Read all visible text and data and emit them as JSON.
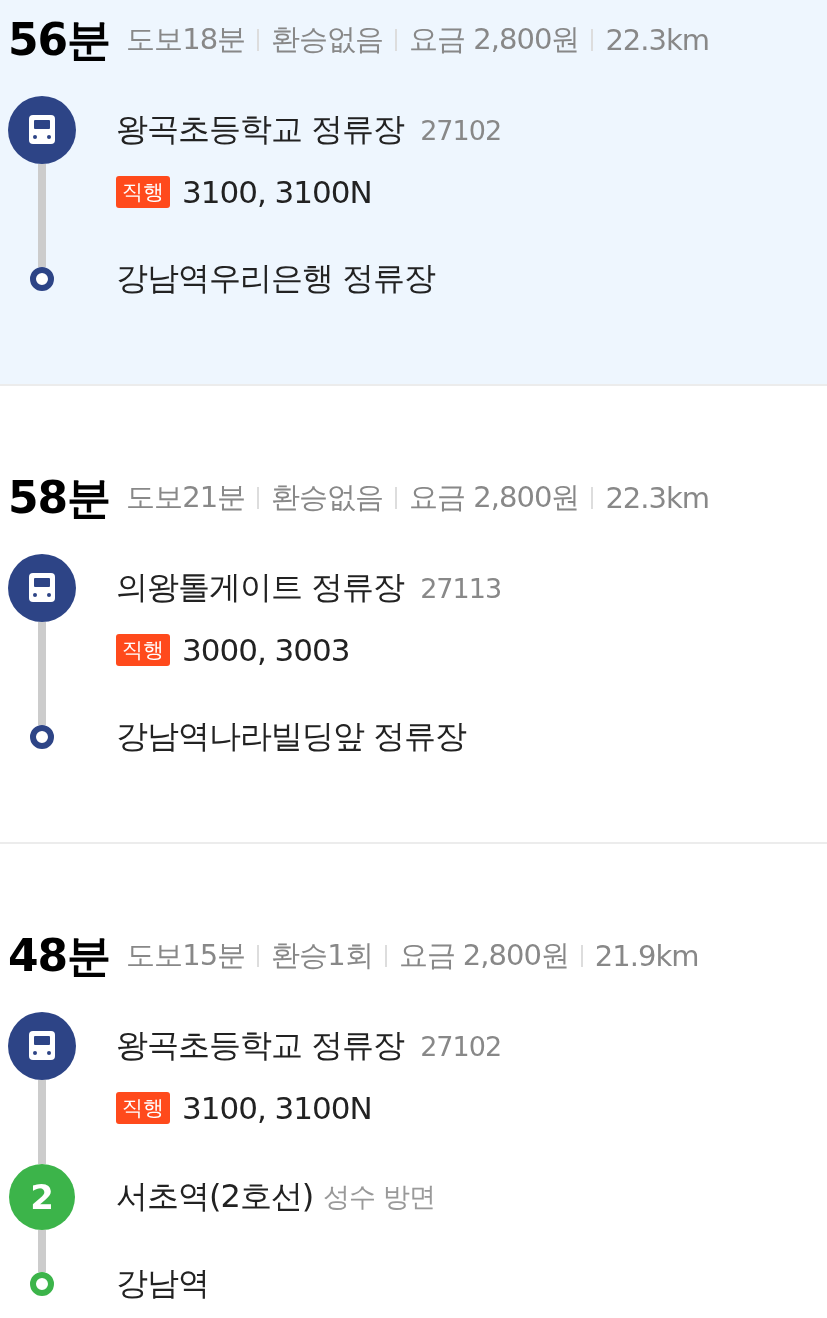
{
  "routes": [
    {
      "selected": true,
      "time": "56분",
      "summary": [
        "도보18분",
        "환승없음",
        "요금 2,800원",
        "22.3km"
      ],
      "steps": [
        {
          "kind": "bus",
          "name": "왕곡초등학교 정류장",
          "stop_id": "27102",
          "badge": "직행",
          "numbers": "3100, 3100N"
        },
        {
          "kind": "end",
          "name": "강남역우리은행 정류장",
          "color": "#2d4486"
        }
      ]
    },
    {
      "selected": false,
      "time": "58분",
      "summary": [
        "도보21분",
        "환승없음",
        "요금 2,800원",
        "22.3km"
      ],
      "steps": [
        {
          "kind": "bus",
          "name": "의왕톨게이트 정류장",
          "stop_id": "27113",
          "badge": "직행",
          "numbers": "3000, 3003"
        },
        {
          "kind": "end",
          "name": "강남역나라빌딩앞 정류장",
          "color": "#2d4486"
        }
      ]
    },
    {
      "selected": false,
      "time": "48분",
      "summary": [
        "도보15분",
        "환승1회",
        "요금 2,800원",
        "21.9km"
      ],
      "steps": [
        {
          "kind": "bus",
          "name": "왕곡초등학교 정류장",
          "stop_id": "27102",
          "badge": "직행",
          "numbers": "3100, 3100N"
        },
        {
          "kind": "subway",
          "name": "서초역(2호선)",
          "line": "2",
          "direction": "성수 방면",
          "color": "#3cb44a"
        },
        {
          "kind": "end",
          "name": "강남역",
          "color": "#3cb44a"
        }
      ]
    }
  ]
}
